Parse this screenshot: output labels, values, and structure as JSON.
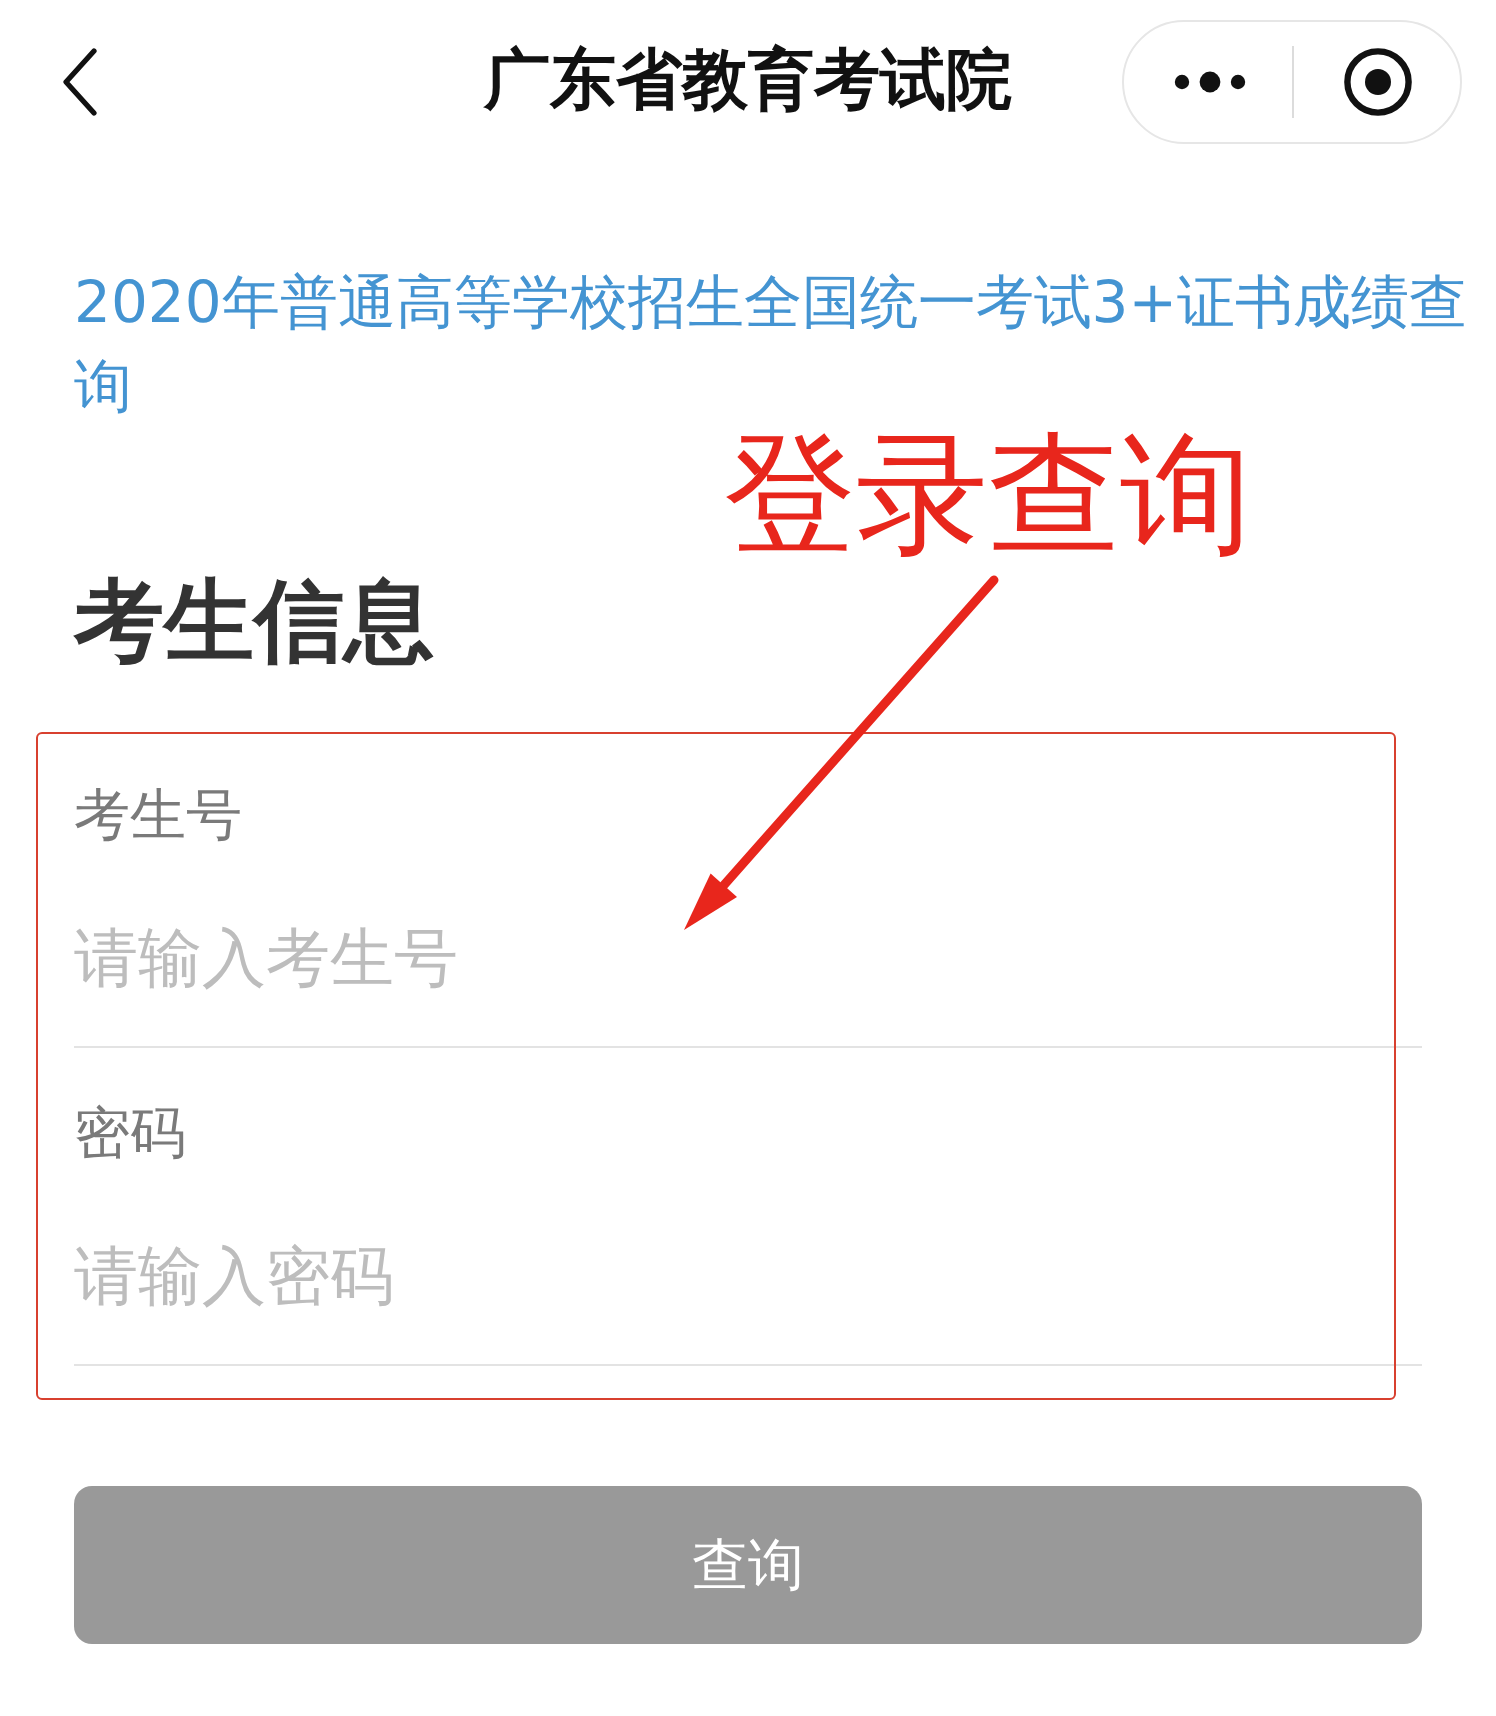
{
  "nav_bar": {
    "title": "广东省教育考试院"
  },
  "exam_link": "2020年普通高等学校招生全国统一考试3+证书成绩查询",
  "annotation": {
    "text": "登录查询"
  },
  "section_title": "考生信息",
  "fields": [
    {
      "label": "考生号",
      "placeholder": "请输入考生号"
    },
    {
      "label": "密码",
      "placeholder": "请输入密码"
    }
  ],
  "submit_button": {
    "label": "查询",
    "disabled": true
  }
}
